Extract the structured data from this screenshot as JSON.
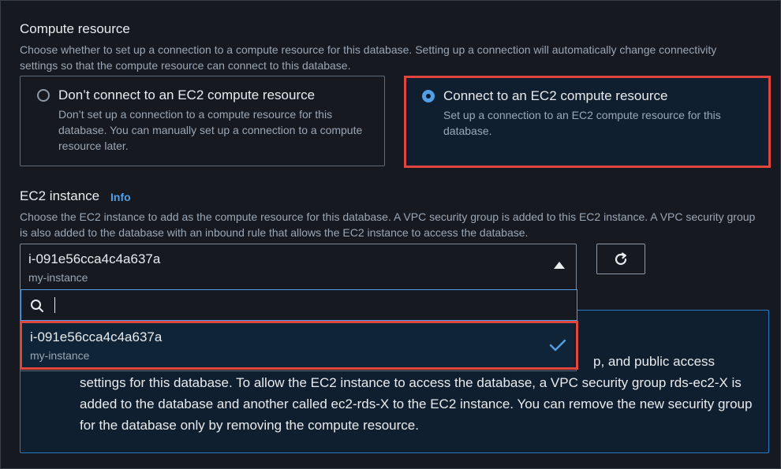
{
  "compute_resource": {
    "title": "Compute resource",
    "description": "Choose whether to set up a connection to a compute resource for this database. Setting up a connection will automatically change connectivity settings so that the compute resource can connect to this database.",
    "options": [
      {
        "title": "Don’t connect to an EC2 compute resource",
        "description": "Don’t set up a connection to a compute resource for this database. You can manually set up a connection to a compute resource later.",
        "selected": false
      },
      {
        "title": "Connect to an EC2 compute resource",
        "description": "Set up a connection to an EC2 compute resource for this database.",
        "selected": true
      }
    ]
  },
  "ec2_instance": {
    "label": "EC2 instance",
    "info_link": "Info",
    "description": "Choose the EC2 instance to add as the compute resource for this database. A VPC security group is added to this EC2 instance. A VPC security group is also added to the database with an inbound rule that allows the EC2 instance to access the database.",
    "selected_value": "i-091e56cca4c4a637a",
    "selected_sub": "my-instance",
    "search_placeholder": "",
    "dropdown_options": [
      {
        "value": "i-091e56cca4c4a637a",
        "sub": "my-instance",
        "selected": true
      }
    ]
  },
  "alert": {
    "tail_text": "p, and public access",
    "body_text": "settings for this database. To allow the EC2 instance to access the database, a VPC security group rds-ec2-X is added to the database and another called ec2-rds-X to the EC2 instance. You can remove the new security group for the database only by removing the compute resource."
  },
  "colors": {
    "accent": "#539fe5",
    "highlight_box": "#e0463e",
    "background": "#16191f"
  },
  "icons": [
    "radio-button",
    "refresh-icon",
    "search-icon",
    "checkmark-icon",
    "caret-up-icon"
  ]
}
